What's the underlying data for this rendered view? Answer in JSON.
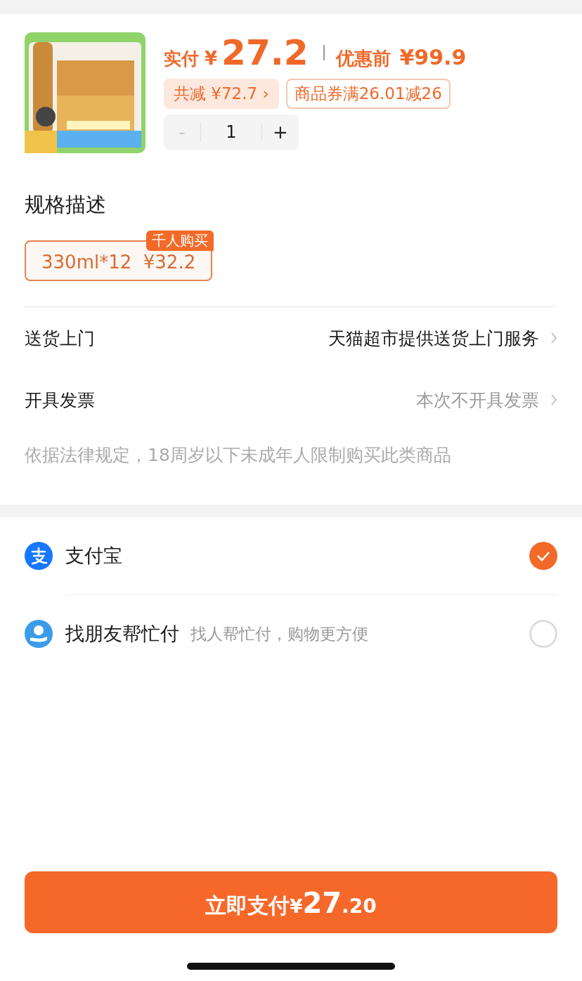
{
  "product": {
    "paid_label": "实付",
    "paid_currency": "¥",
    "paid_amount": "27.2",
    "original_label": "优惠前",
    "original_price": "¥99.9",
    "discount": "共减 ¥72.7",
    "discount_arrow": "›",
    "coupon": "商品券满26.01减26",
    "quantity": {
      "minus": "-",
      "value": "1",
      "plus": "+",
      "minus_disabled": true
    }
  },
  "spec": {
    "title": "规格描述",
    "options": [
      {
        "label": "330ml*12",
        "price": "¥32.2",
        "badge": "千人购买",
        "selected": true
      }
    ]
  },
  "rows": [
    {
      "label": "送货上门",
      "value": "天猫超市提供送货上门服务",
      "emphasis": true
    },
    {
      "label": "开具发票",
      "value": "本次不开具发票",
      "emphasis": false
    }
  ],
  "notice": "依据法律规定，18周岁以下未成年人限制购买此类商品",
  "payment_methods": [
    {
      "kind": "alipay",
      "name": "支付宝",
      "selected": true
    },
    {
      "kind": "friend",
      "name": "找朋友帮忙付",
      "hint": "找人帮忙付，购物更方便",
      "selected": false
    }
  ],
  "pay_button": {
    "label": "立即支付",
    "currency": "¥",
    "integer": "27",
    "decimal": ".20"
  }
}
